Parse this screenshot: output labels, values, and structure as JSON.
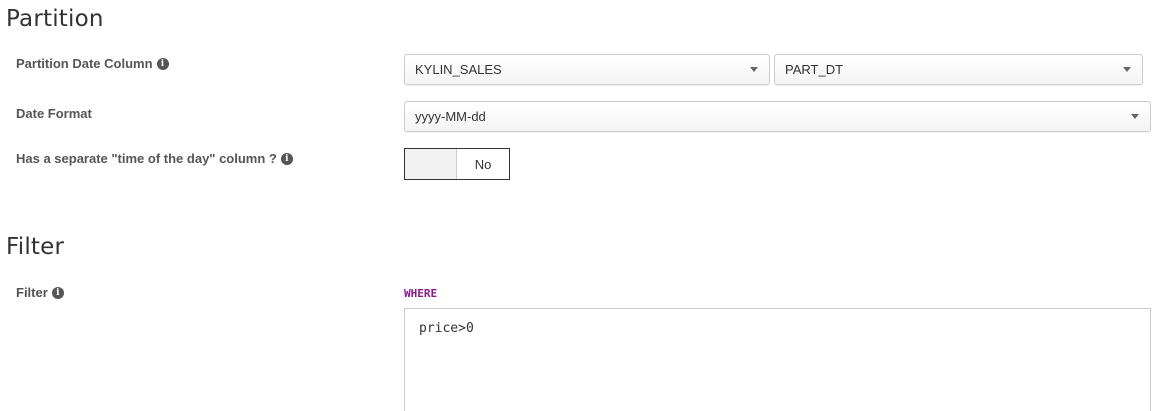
{
  "partition": {
    "title": "Partition",
    "date_column": {
      "label": "Partition Date Column",
      "table_value": "KYLIN_SALES",
      "column_value": "PART_DT"
    },
    "date_format": {
      "label": "Date Format",
      "value": "yyyy-MM-dd"
    },
    "time_of_day": {
      "label": "Has a separate \"time of the day\" column ?",
      "toggle_state": "No"
    }
  },
  "filter": {
    "title": "Filter",
    "label": "Filter",
    "keyword": "WHERE",
    "condition": "price>0"
  },
  "icons": {
    "info_glyph": "i"
  },
  "colors": {
    "keyword": "#8b1a8b",
    "label": "#555555"
  }
}
